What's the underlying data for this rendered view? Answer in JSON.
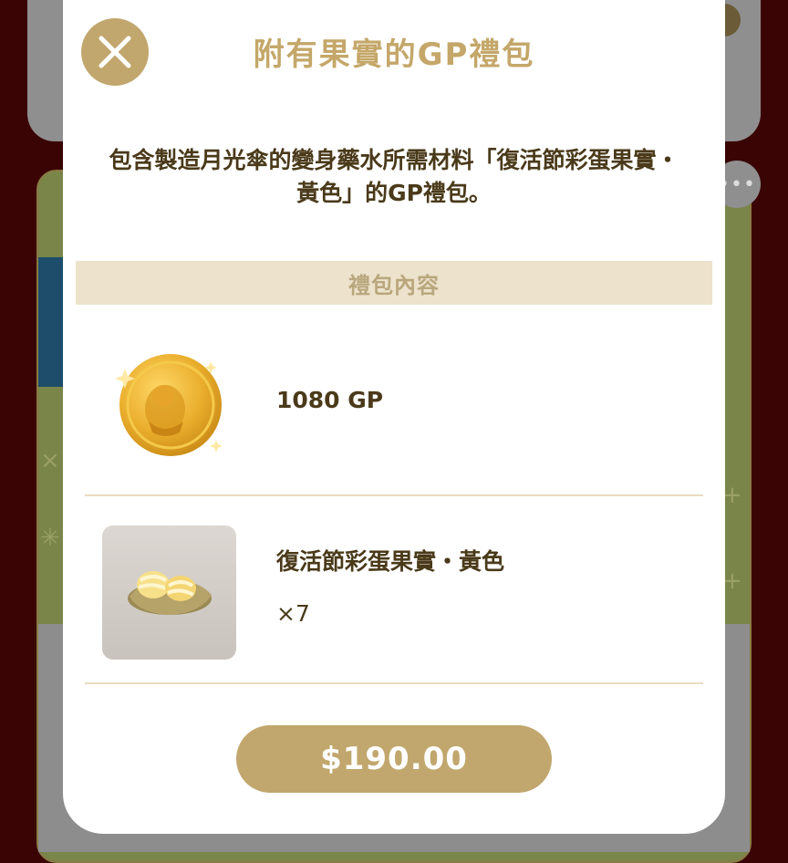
{
  "modal": {
    "title": "附有果實的GP禮包",
    "description": "包含製造月光傘的變身藥水所需材料「復活節彩蛋果實・黃色」的GP禮包。",
    "section_header": "禮包內容",
    "items": [
      {
        "name": "1080 GP",
        "icon": "gold-coin-icon"
      },
      {
        "name": "復活節彩蛋果實・黃色",
        "quantity": "×7",
        "icon": "yellow-easter-egg-fruit-icon"
      }
    ],
    "price_label": "$190.00",
    "close_icon": "close-icon"
  },
  "colors": {
    "accent": "#c1a76d",
    "title_text": "#c4a769",
    "body_text": "#4a3a1a",
    "section_bg": "#ede2cb"
  }
}
